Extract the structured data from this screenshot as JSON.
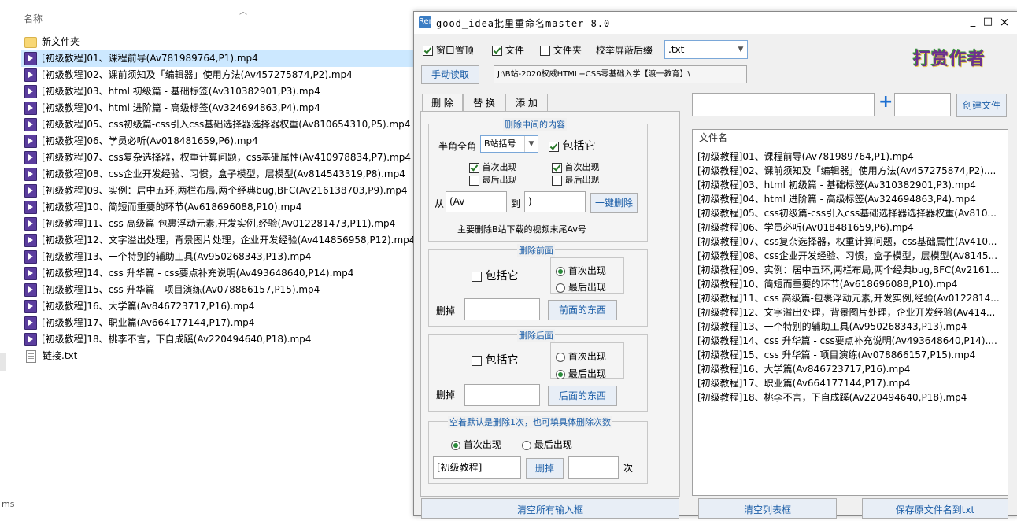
{
  "explorer": {
    "header": "名称",
    "files": [
      {
        "name": "新文件夹",
        "type": "folder"
      },
      {
        "name": "[初级教程]01、课程前导(Av781989764,P1).mp4",
        "type": "video",
        "selected": true
      },
      {
        "name": "[初级教程]02、课前须知及「编辑器」使用方法(Av457275874,P2).mp4",
        "type": "video"
      },
      {
        "name": "[初级教程]03、html 初级篇 - 基础标签(Av310382901,P3).mp4",
        "type": "video"
      },
      {
        "name": "[初级教程]04、html 进阶篇 - 高级标签(Av324694863,P4).mp4",
        "type": "video"
      },
      {
        "name": "[初级教程]05、css初级篇-css引入css基础选择器选择器权重(Av810654310,P5).mp4",
        "type": "video"
      },
      {
        "name": "[初级教程]06、学员必听(Av018481659,P6).mp4",
        "type": "video"
      },
      {
        "name": "[初级教程]07、css复杂选择器，权重计算问题，css基础属性(Av410978834,P7).mp4",
        "type": "video"
      },
      {
        "name": "[初级教程]08、css企业开发经验、习惯，盒子模型，层模型(Av814543319,P8).mp4",
        "type": "video"
      },
      {
        "name": "[初级教程]09、实例：居中五环,两栏布局,两个经典bug,BFC(Av216138703,P9).mp4",
        "type": "video"
      },
      {
        "name": "[初级教程]10、简短而重要的环节(Av618696088,P10).mp4",
        "type": "video"
      },
      {
        "name": "[初级教程]11、css 高级篇-包裹浮动元素,开发实例,经验(Av012281473,P11).mp4",
        "type": "video"
      },
      {
        "name": "[初级教程]12、文字溢出处理，背景图片处理，企业开发经验(Av414856958,P12).mp4",
        "type": "video"
      },
      {
        "name": "[初级教程]13、一个特别的辅助工具(Av950268343,P13).mp4",
        "type": "video"
      },
      {
        "name": "[初级教程]14、css 升华篇 - css要点补充说明(Av493648640,P14).mp4",
        "type": "video"
      },
      {
        "name": "[初级教程]15、css 升华篇 - 项目演练(Av078866157,P15).mp4",
        "type": "video"
      },
      {
        "name": "[初级教程]16、大学篇(Av846723717,P16).mp4",
        "type": "video"
      },
      {
        "name": "[初级教程]17、职业篇(Av664177144,P17).mp4",
        "type": "video"
      },
      {
        "name": "[初级教程]18、桃李不言，下自成蹊(Av220494640,P18).mp4",
        "type": "video"
      },
      {
        "name": "链接.txt",
        "type": "txt"
      }
    ],
    "status_fragment": "ms"
  },
  "dialog": {
    "title": "good_idea批里重命名master-8.0",
    "app_icon": "Ren",
    "window_buttons": {
      "minimize": "_",
      "maximize": "□",
      "close": "×"
    },
    "options": {
      "window_top": {
        "label": "窗口置顶",
        "checked": true
      },
      "file": {
        "label": "文件",
        "checked": true
      },
      "folder": {
        "label": "文件夹",
        "checked": false
      },
      "suffix_label": "校举屏蔽后缀",
      "suffix_value": ".txt"
    },
    "logo_text": "打赏作者",
    "manual_read_button": "手动读取",
    "path_value": "J:\\B站-2020权威HTML+CSS零基础入学【渡一教育】\\",
    "tabs": [
      "删 除",
      "替 换",
      "添 加"
    ],
    "delete_middle": {
      "title": "删除中间的内容",
      "width_label": "半角全角",
      "width_value": "B站括号",
      "include_label": "包括它",
      "include_checked": true,
      "left_first": "首次出现",
      "left_last": "最后出现",
      "right_first": "首次出现",
      "right_last": "最后出现",
      "from_label": "从",
      "from_value": "(Av",
      "to_label": "到",
      "to_value": ")",
      "action_button": "一键删除",
      "note": "主要删除B站下载的视频末尾Av号"
    },
    "delete_front": {
      "title": "删除前面",
      "include_label": "包括它",
      "first_label": "首次出现",
      "last_label": "最后出现",
      "selected": "first",
      "remove_label": "删掉",
      "remove_value": "",
      "action_button": "前面的东西"
    },
    "delete_back": {
      "title": "删除后面",
      "include_label": "包括它",
      "first_label": "首次出现",
      "last_label": "最后出现",
      "selected": "last",
      "remove_label": "删掉",
      "remove_value": "",
      "action_button": "后面的东西"
    },
    "delete_count": {
      "title": "空着默认是删除1次，也可填具体删除次数",
      "first_label": "首次出现",
      "last_label": "最后出现",
      "selected": "first",
      "text_value": "[初级教程]",
      "action_button": "删掉",
      "count_value": "",
      "count_unit": "次"
    },
    "create": {
      "plus": "+",
      "button": "创建文件"
    },
    "list": {
      "header": "文件名",
      "rows": [
        "[初级教程]01、课程前导(Av781989764,P1).mp4",
        "[初级教程]02、课前须知及「编辑器」使用方法(Av457275874,P2)....",
        "[初级教程]03、html 初级篇 - 基础标签(Av310382901,P3).mp4",
        "[初级教程]04、html 进阶篇 - 高级标签(Av324694863,P4).mp4",
        "[初级教程]05、css初级篇-css引入css基础选择器选择器权重(Av810...",
        "[初级教程]06、学员必听(Av018481659,P6).mp4",
        "[初级教程]07、css复杂选择器，权重计算问题，css基础属性(Av410...",
        "[初级教程]08、css企业开发经验、习惯，盒子模型，层模型(Av8145...",
        "[初级教程]09、实例：居中五环,两栏布局,两个经典bug,BFC(Av2161...",
        "[初级教程]10、简短而重要的环节(Av618696088,P10).mp4",
        "[初级教程]11、css 高级篇-包裹浮动元素,开发实例,经验(Av0122814...",
        "[初级教程]12、文字溢出处理，背景图片处理，企业开发经验(Av414...",
        "[初级教程]13、一个特别的辅助工具(Av950268343,P13).mp4",
        "[初级教程]14、css 升华篇 - css要点补充说明(Av493648640,P14)....",
        "[初级教程]15、css 升华篇 - 项目演练(Av078866157,P15).mp4",
        "[初级教程]16、大学篇(Av846723717,P16).mp4",
        "[初级教程]17、职业篇(Av664177144,P17).mp4",
        "[初级教程]18、桃李不言，下自成蹊(Av220494640,P18).mp4"
      ]
    },
    "bottom_buttons": [
      "清空所有输入框",
      "清空列表框",
      "保存原文件名到txt"
    ]
  }
}
